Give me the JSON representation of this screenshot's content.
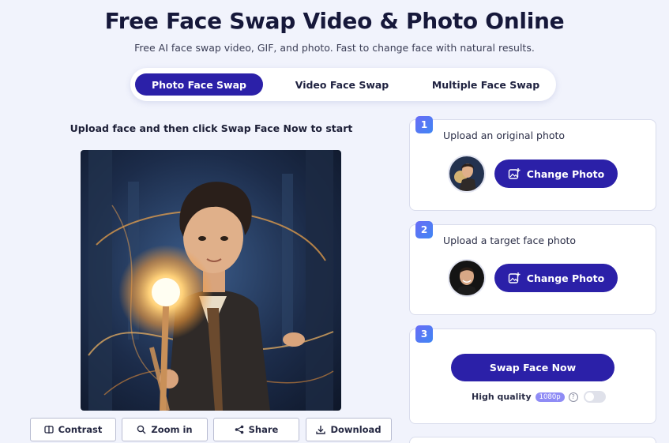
{
  "header": {
    "title": "Free Face Swap Video & Photo Online",
    "subtitle": "Free AI face swap video, GIF, and photo. Fast to change face with natural results."
  },
  "tabs": [
    {
      "label": "Photo Face Swap",
      "active": true
    },
    {
      "label": "Video Face Swap",
      "active": false
    },
    {
      "label": "Multiple Face Swap",
      "active": false
    }
  ],
  "main": {
    "hint": "Upload face and then click Swap Face Now to start"
  },
  "toolbar": {
    "contrast": "Contrast",
    "zoom_in": "Zoom in",
    "share": "Share",
    "download": "Download"
  },
  "steps": [
    {
      "number": "1",
      "label": "Upload an original photo",
      "button": "Change Photo"
    },
    {
      "number": "2",
      "label": "Upload a target face photo",
      "button": "Change Photo"
    },
    {
      "number": "3",
      "button": "Swap Face Now",
      "quality_label": "High quality",
      "quality_badge": "1080p",
      "help": "?",
      "quality_enabled": false
    }
  ],
  "colors": {
    "primary": "#2b20a8",
    "background": "#f1f3fc",
    "step_badge": "#5b78f5"
  }
}
